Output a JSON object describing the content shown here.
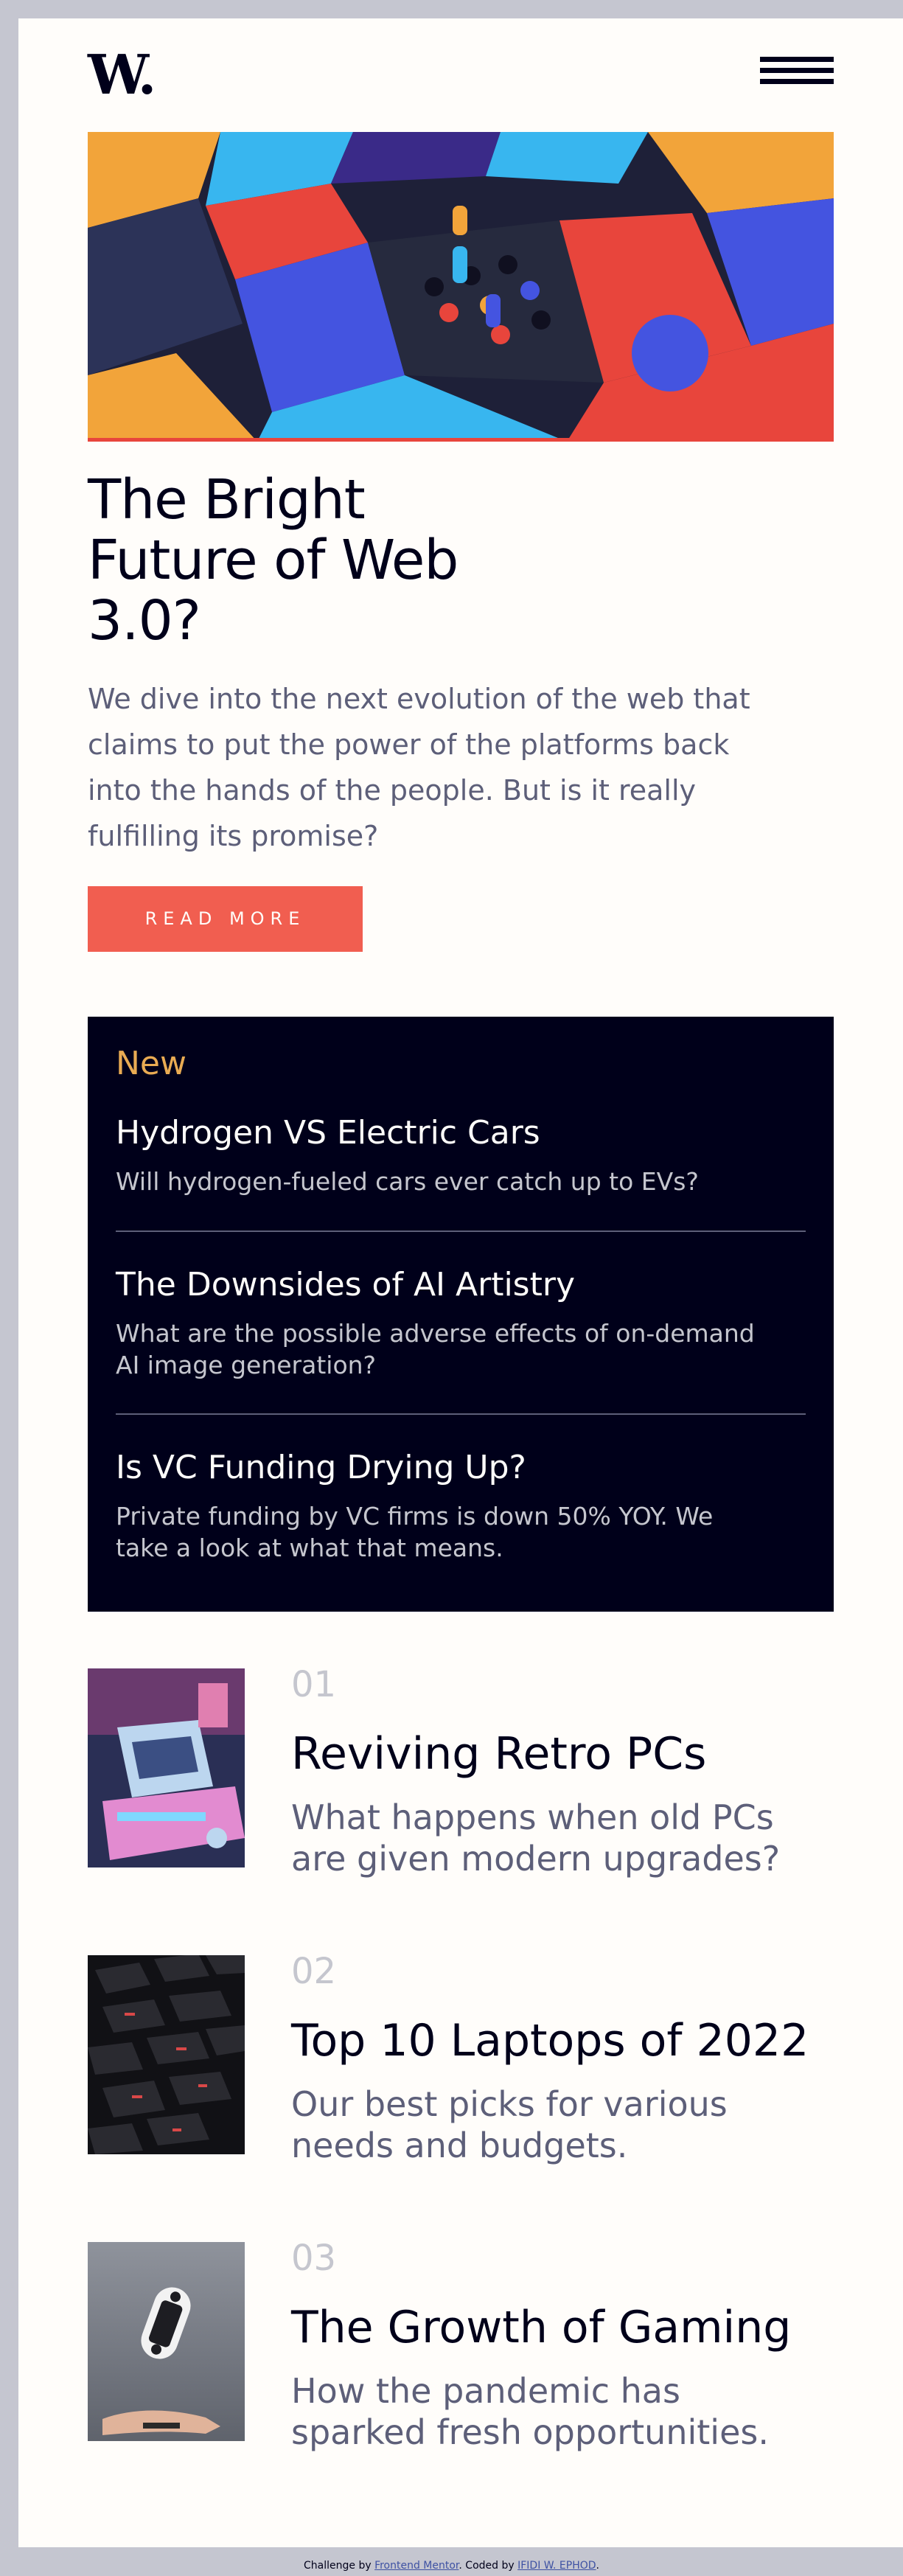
{
  "header": {
    "logo_text": "W.",
    "menu_icon": "hamburger-menu-icon"
  },
  "hero": {
    "image_icon": "abstract-3d-blocks-image",
    "title_lines": [
      "The Bright",
      "Future of Web",
      "3.0?"
    ],
    "description": "We dive into the next evolution of the web that claims to put the power of the platforms back into the hands of the people. But is it really fulfilling its promise?",
    "button_label": "READ MORE"
  },
  "new_panel": {
    "heading": "New",
    "items": [
      {
        "title": "Hydrogen VS Electric Cars",
        "description": "Will hydrogen-fueled cars ever catch up to EVs?"
      },
      {
        "title": "The Downsides of AI Artistry",
        "description": "What are the possible adverse effects of on-demand AI image generation?"
      },
      {
        "title": "Is VC Funding Drying Up?",
        "description": "Private funding by VC firms is down 50% YOY. We take a look at what that means."
      }
    ]
  },
  "articles": [
    {
      "number": "01",
      "title": "Reviving Retro PCs",
      "description": "What happens when old PCs are given modern upgrades?",
      "image_icon": "retro-pc-image"
    },
    {
      "number": "02",
      "title": "Top 10 Laptops of 2022",
      "description": "Our best picks for various needs and budgets.",
      "image_icon": "laptop-keyboard-image"
    },
    {
      "number": "03",
      "title": "The Growth of Gaming",
      "description": "How the pandemic has sparked fresh opportunities.",
      "image_icon": "gamepad-image"
    }
  ],
  "attribution": {
    "prefix": "Challenge by",
    "link1": "Frontend Mentor",
    "middle": ". Coded by",
    "link2": "IFIDI W. EPHOD",
    "suffix": "."
  },
  "colors": {
    "accent": "#f15e50",
    "new_heading": "#e9ab53",
    "dark": "#00001a",
    "background": "#fffdfa",
    "muted": "#5d5f79",
    "outer": "#c5c6d0"
  }
}
